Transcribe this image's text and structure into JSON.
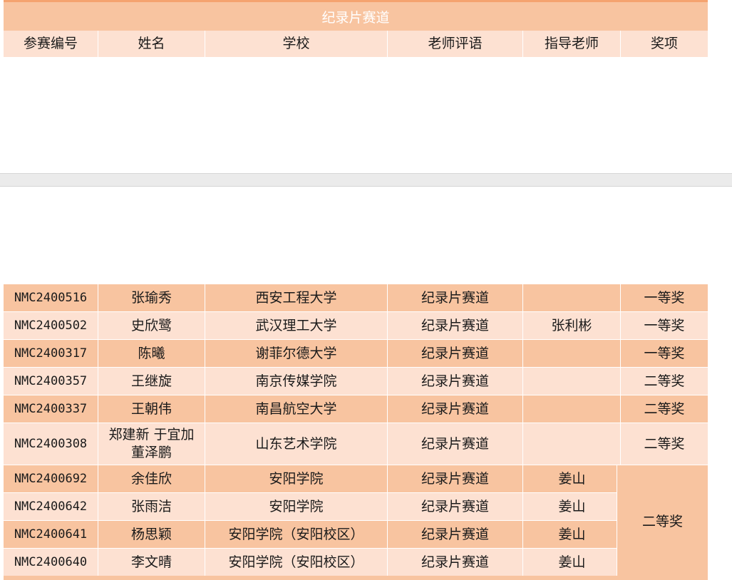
{
  "sheet": {
    "title": "纪录片赛道",
    "headers": [
      "参赛编号",
      "姓名",
      "学校",
      "老师评语",
      "指导老师",
      "奖项"
    ],
    "rows": [
      {
        "id": "NMC2400516",
        "name": "张瑜秀",
        "school": "西安工程大学",
        "comment": "纪录片赛道",
        "teacher": "",
        "award": "一等奖"
      },
      {
        "id": "NMC2400502",
        "name": "史欣鹭",
        "school": "武汉理工大学",
        "comment": "纪录片赛道",
        "teacher": "张利彬",
        "award": "一等奖"
      },
      {
        "id": "NMC2400317",
        "name": "陈曦",
        "school": "谢菲尔德大学",
        "comment": "纪录片赛道",
        "teacher": "",
        "award": "一等奖"
      },
      {
        "id": "NMC2400357",
        "name": "王继旋",
        "school": "南京传媒学院",
        "comment": "纪录片赛道",
        "teacher": "",
        "award": "二等奖"
      },
      {
        "id": "NMC2400337",
        "name": "王朝伟",
        "school": "南昌航空大学",
        "comment": "纪录片赛道",
        "teacher": "",
        "award": "二等奖"
      },
      {
        "id": "NMC2400308",
        "name": "郑建新 于宜加 董泽鹏",
        "school": "山东艺术学院",
        "comment": "纪录片赛道",
        "teacher": "",
        "award": "二等奖"
      },
      {
        "id": "NMC2400692",
        "name": "余佳欣",
        "school": "安阳学院",
        "comment": "纪录片赛道",
        "teacher": "姜山",
        "award": ""
      },
      {
        "id": "NMC2400642",
        "name": "张雨洁",
        "school": "安阳学院",
        "comment": "纪录片赛道",
        "teacher": "姜山",
        "award": ""
      },
      {
        "id": "NMC2400641",
        "name": "杨思颖",
        "school": "安阳学院（安阳校区）",
        "comment": "纪录片赛道",
        "teacher": "姜山",
        "award": ""
      },
      {
        "id": "NMC2400640",
        "name": "李文晴",
        "school": "安阳学院（安阳校区）",
        "comment": "纪录片赛道",
        "teacher": "姜山",
        "award": ""
      }
    ],
    "merged_award": "二等奖"
  }
}
